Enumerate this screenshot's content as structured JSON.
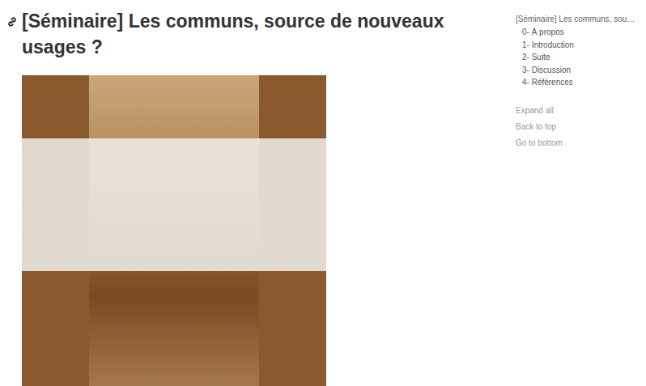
{
  "article": {
    "title": "[Séminaire] Les communs, source de nouveaux usages ?"
  },
  "toc": {
    "title": "[Séminaire] Les communs, sou…",
    "items": [
      {
        "label": "0- À propos"
      },
      {
        "label": "1- Introduction"
      },
      {
        "label": "2- Suite"
      },
      {
        "label": "3- Discussion"
      },
      {
        "label": "4- Références"
      }
    ]
  },
  "actions": [
    "Expand all",
    "Back to top",
    "Go to bottom"
  ]
}
